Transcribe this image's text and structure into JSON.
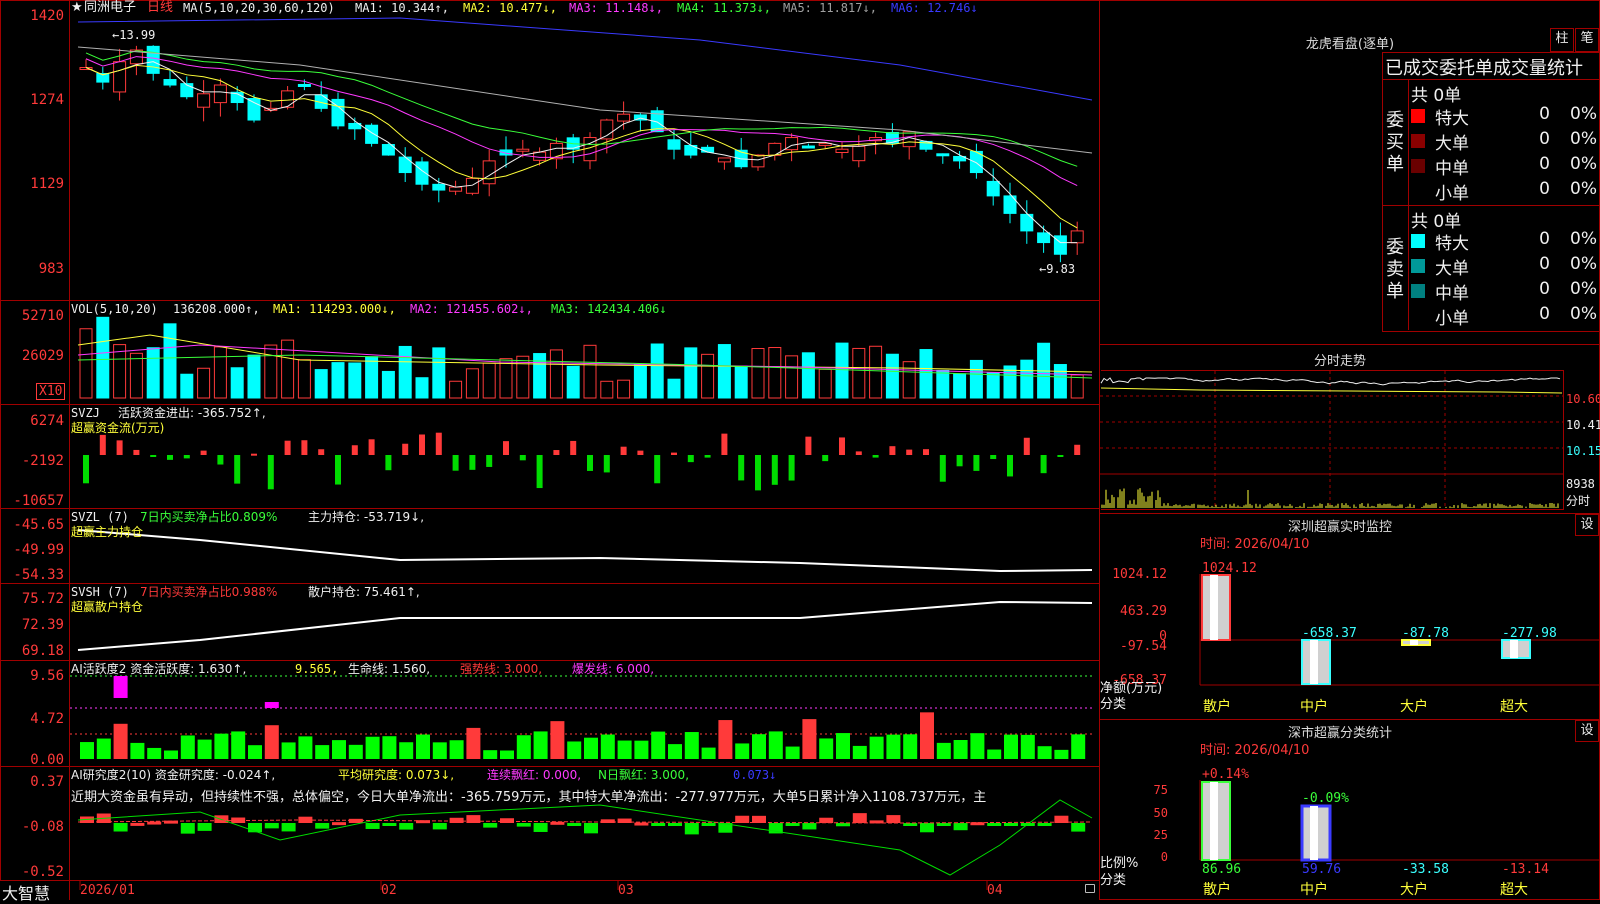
{
  "colors": {
    "up": "#ff3a3a",
    "down": "#00ffff",
    "grid": "#a00000",
    "ma1": "#f0f0f0",
    "ma2": "#ffff3a",
    "ma3": "#ff3aff",
    "ma4": "#3aff3a",
    "ma5": "#b0b0b0",
    "ma6": "#3a3aff"
  },
  "kline": {
    "title_star": "★",
    "stock_name": "同洲电子",
    "period": "日线",
    "ma_header": "MA(5,10,20,30,60,120)",
    "ma1": "MA1: 10.344↑,",
    "ma2": "MA2: 10.477↓,",
    "ma3": "MA3: 11.148↓,",
    "ma4": "MA4: 11.373↓,",
    "ma5": "MA5: 11.817↓,",
    "ma6": "MA6: 12.746↓",
    "y_labels": [
      "1420",
      "1274",
      "1129",
      "983"
    ],
    "high_mark": "←13.99",
    "low_mark": "←9.83"
  },
  "vol": {
    "header": "VOL(5,10,20)",
    "value": "136208.000↑,",
    "ma1": "MA1: 114293.000↓,",
    "ma2": "MA2: 121455.602↓,",
    "ma3": "MA3: 142434.406↓",
    "y_labels": [
      "52710",
      "26029"
    ],
    "unit": "X10"
  },
  "svzj": {
    "header": "SVZJ",
    "label": "活跃资金进出: -365.752↑,",
    "sub": "超赢资金流(万元)",
    "y_labels": [
      "6274",
      "-2192",
      "-10657"
    ]
  },
  "svzl": {
    "header": "SVZL (7)",
    "pct": "7日内买卖净占比0.809%",
    "label": "主力持仓: -53.719↓,",
    "sub": "超赢主力持仓",
    "y_labels": [
      "-45.65",
      "-49.99",
      "-54.33"
    ]
  },
  "svsh": {
    "header": "SVSH (7)",
    "pct": "7日内买卖净占比0.988%",
    "label": "散户持仓: 75.461↑,",
    "sub": "超赢散户持仓",
    "y_labels": [
      "75.72",
      "72.39",
      "69.18"
    ]
  },
  "ai1": {
    "header": "AI活跃度2 资金活跃度: 1.630↑,",
    "v2": "9.565,",
    "life": "生命线: 1.560,",
    "strong": "强势线: 3.000,",
    "burst": "爆发线: 6.000,",
    "y_labels": [
      "9.56",
      "4.72",
      "0.00"
    ]
  },
  "ai2": {
    "header": "AI研究度2(10) 资金研究度: -0.024↑,",
    "avg": "平均研究度: 0.073↓,",
    "lianxu": "连续飘红: 0.000,",
    "nri": "N日飘红: 3.000,",
    "v": "0.073↓",
    "comment": "近期大资金虽有异动，但持续性不强，总体偏空，今日大单净流出：-365.759万元，其中特大单净流出：-277.977万元，大单5日累计净入1108.737万元，主",
    "y_labels": [
      "0.37",
      "-0.08",
      "-0.52"
    ]
  },
  "xaxis": {
    "brand": "大智慧",
    "labels": [
      "2026/01",
      "02",
      "03",
      "04"
    ]
  },
  "dragon": {
    "title": "龙虎看盘(逐单)",
    "btn_zhu": "柱",
    "btn_bi": "笔",
    "header": "已成交委托单成交量统计",
    "buy_label": "委买单",
    "sell_label": "委卖单",
    "buy_total": "共 0单",
    "sell_total": "共 0单",
    "buy_rows": [
      {
        "name": "特大",
        "n": "0",
        "p": "0%",
        "c": "#ff0000"
      },
      {
        "name": "大单",
        "n": "0",
        "p": "0%",
        "c": "#8b0000"
      },
      {
        "name": "中单",
        "n": "0",
        "p": "0%",
        "c": "#6a0000"
      },
      {
        "name": "小单",
        "n": "0",
        "p": "0%",
        "c": ""
      }
    ],
    "sell_rows": [
      {
        "name": "特大",
        "n": "0",
        "p": "0%",
        "c": "#00ffff"
      },
      {
        "name": "大单",
        "n": "0",
        "p": "0%",
        "c": "#009999"
      },
      {
        "name": "中单",
        "n": "0",
        "p": "0%",
        "c": "#008080"
      },
      {
        "name": "小单",
        "n": "0",
        "p": "0%",
        "c": ""
      }
    ]
  },
  "fenshi": {
    "title": "分时走势",
    "prices": [
      "10.60",
      "10.41",
      "10.15"
    ],
    "vol": "8938",
    "unit": "分时"
  },
  "szmon": {
    "title": "深圳超赢实时监控",
    "btn": "设",
    "time": "时间: 2026/04/10",
    "y_labels": [
      "1024.12",
      "463.29",
      "0",
      "-97.54",
      "-658.37"
    ],
    "yunit": "净额(万元)",
    "xunit": "分类",
    "cats": [
      "散户",
      "中户",
      "大户",
      "超大"
    ],
    "bar_labels": [
      "1024.12",
      "-658.37",
      "-87.78",
      "-277.98"
    ]
  },
  "szcls": {
    "title": "深市超赢分类统计",
    "btn": "设",
    "time": "时间: 2026/04/10",
    "y_labels": [
      "75",
      "50",
      "25",
      "0"
    ],
    "yunit": "比例%",
    "xunit": "分类",
    "cats": [
      "散户",
      "中户",
      "大户",
      "超大"
    ],
    "top_labels": [
      "+0.14%",
      "-0.09%"
    ],
    "bottom_labels": [
      "86.96",
      "59.76",
      "-33.58",
      "-13.14"
    ]
  }
}
